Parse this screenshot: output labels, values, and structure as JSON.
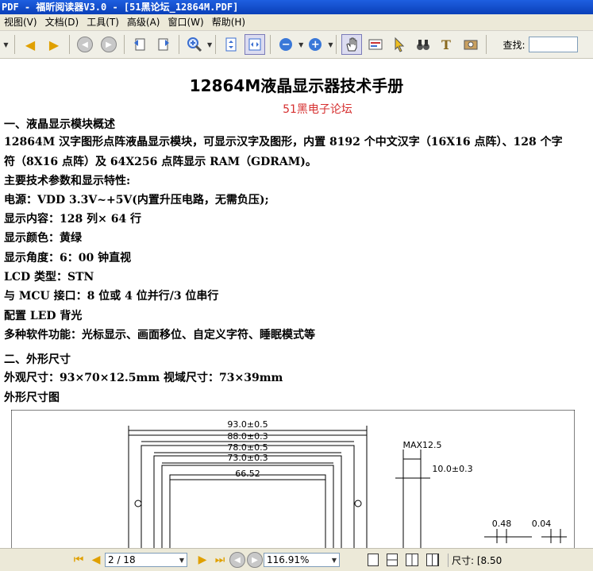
{
  "window": {
    "title": "PDF - 福昕阅读器V3.0 - [51黑论坛_12864M.PDF]"
  },
  "menu": [
    "视图(V)",
    "文档(D)",
    "工具(T)",
    "高级(A)",
    "窗口(W)",
    "帮助(H)"
  ],
  "toolbar": {
    "icons": [
      "dropdown-icon",
      "arrow-left-icon",
      "arrow-right-icon",
      "back-icon",
      "forward-icon",
      "rotate-left-icon",
      "rotate-right-icon",
      "zoom-in-icon",
      "fit-page-icon",
      "fit-width-icon",
      "zoom-out-circle-icon",
      "zoom-in-circle-icon",
      "hand-tool-icon",
      "text-select-icon",
      "cursor-icon",
      "binoculars-icon",
      "typewriter-icon",
      "snapshot-icon"
    ],
    "search_label": "查找:",
    "search_value": ""
  },
  "document": {
    "title": "12864M液晶显示器技术手册",
    "subtitle": "51黑电子论坛",
    "sec1_heading": "一、液晶显示模块概述",
    "para1_line1": "12864M 汉字图形点阵液晶显示模块，可显示汉字及图形，内置 8192 个中文汉字（16X16 点阵）、128 个字",
    "para1_line2": "符（8X16 点阵）及 64X256 点阵显示 RAM（GDRAM)。",
    "main_params": "主要技术参数和显示特性:",
    "power": "电源：VDD 3.3V~+5V(内置升压电路，无需负压);",
    "content": "显示内容：128 列× 64 行",
    "color": "显示颜色：黄绿",
    "angle": "显示角度：6：00 钟直视",
    "lcd_type": "LCD 类型：STN",
    "mcu": "与 MCU 接口：8 位或 4 位并行/3 位串行",
    "backlight": "配置 LED 背光",
    "functions": "多种软件功能：光标显示、画面移位、自定义字符、睡眠模式等",
    "sec2_heading": "二、外形尺寸",
    "outline_size": "外观尺寸：93×70×12.5mm  视域尺寸：73×39mm",
    "outline_drawing": "外形尺寸图"
  },
  "drawing": {
    "dims": [
      "93.0±0.5",
      "88.0±0.3",
      "78.0±0.5",
      "73.0±0.3",
      "66.52"
    ],
    "side_dims": [
      "MAX12.5",
      "10.0±0.3"
    ],
    "small_dims": [
      "0.48",
      "0.04"
    ]
  },
  "statusbar": {
    "page_value": "2 / 18",
    "zoom_value": "116.91%",
    "size_label": "尺寸: [8.50"
  }
}
